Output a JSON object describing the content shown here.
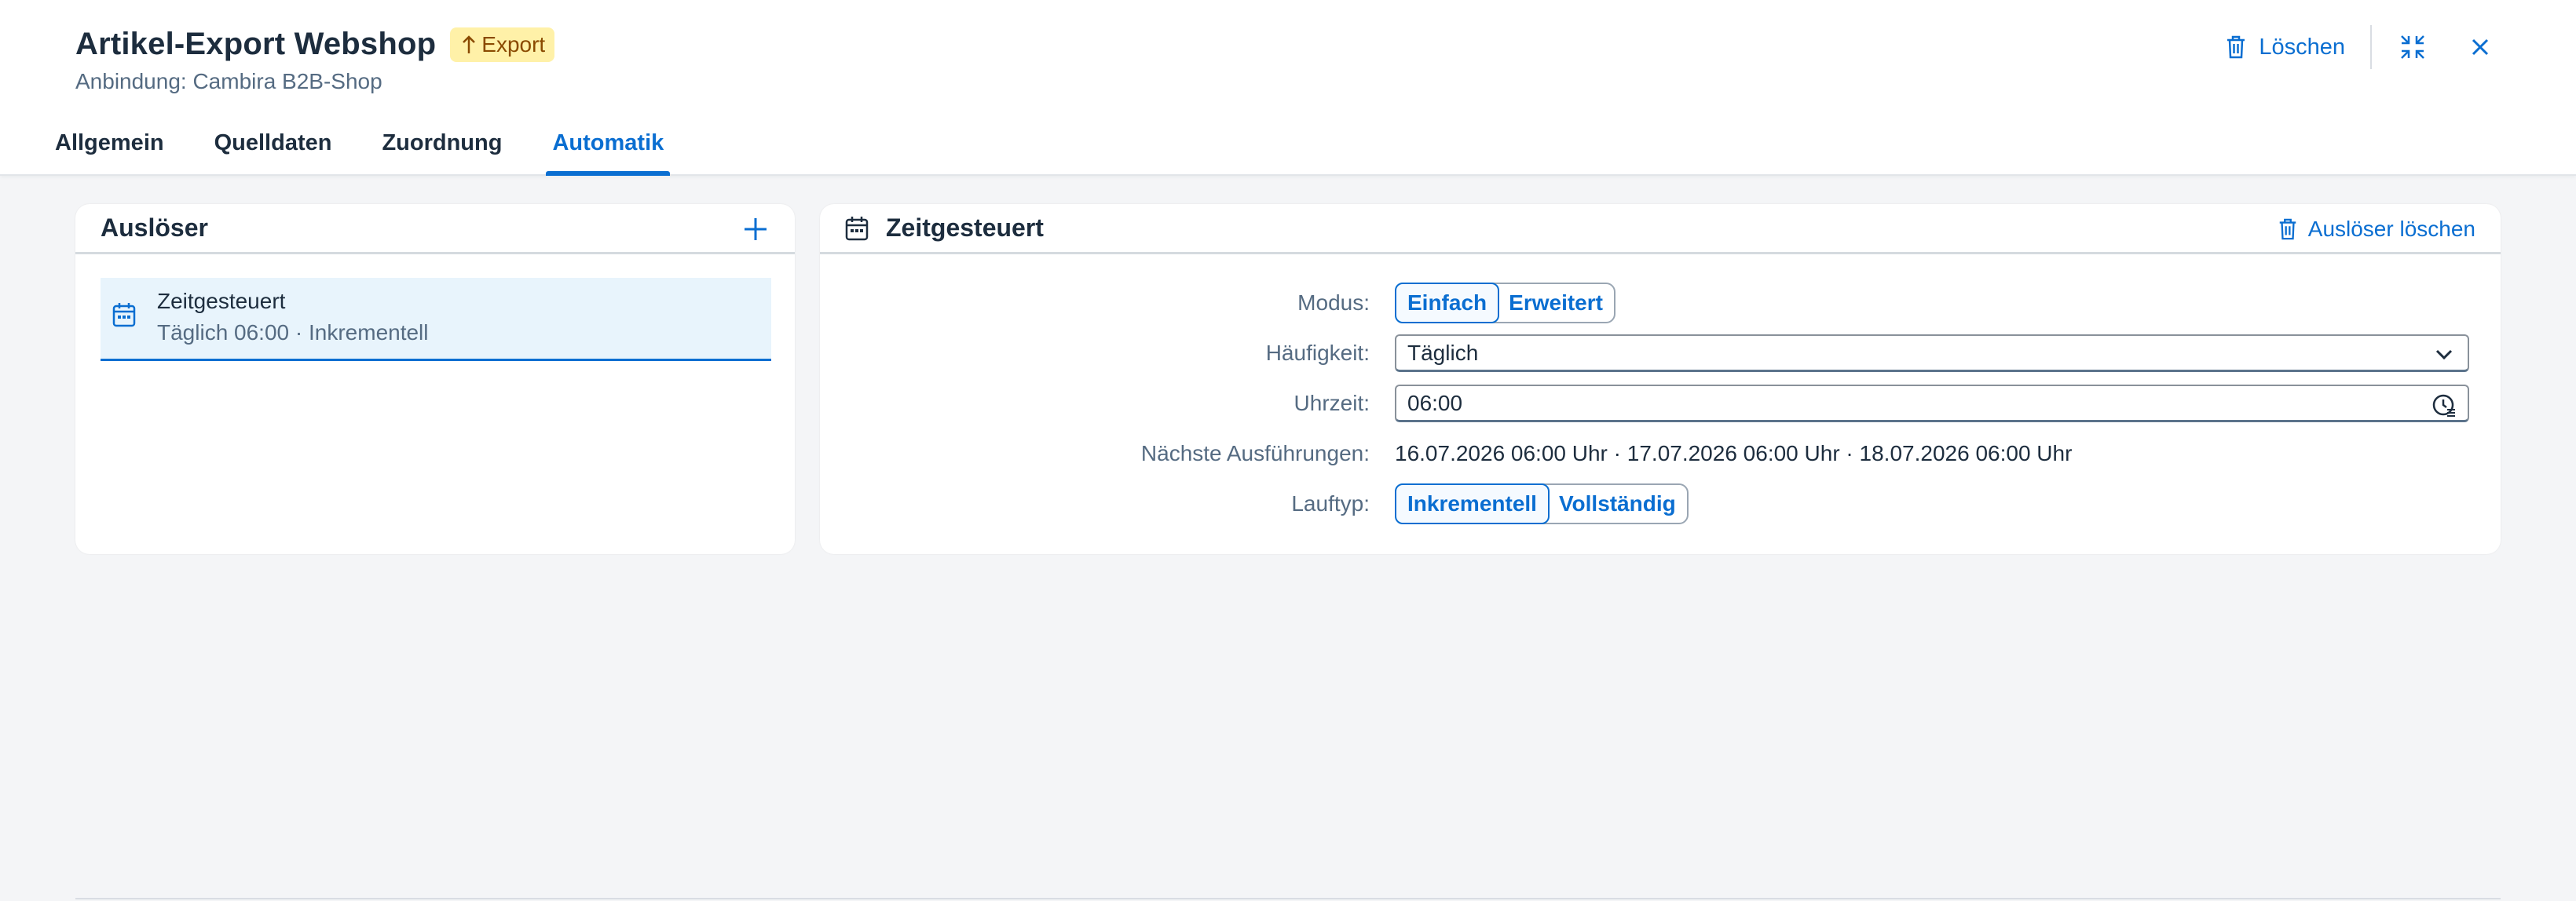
{
  "header": {
    "title": "Artikel-Export Webshop",
    "badge": "Export",
    "subtitle": "Anbindung: Cambira B2B-Shop",
    "delete_label": "Löschen"
  },
  "tabs": [
    {
      "label": "Allgemein"
    },
    {
      "label": "Quelldaten"
    },
    {
      "label": "Zuordnung"
    },
    {
      "label": "Automatik"
    }
  ],
  "triggers_panel": {
    "title": "Auslöser",
    "items": [
      {
        "title": "Zeitgesteuert",
        "description": "Täglich 06:00 · Inkrementell"
      }
    ]
  },
  "detail": {
    "title": "Zeitgesteuert",
    "delete_trigger_label": "Auslöser löschen",
    "mode": {
      "label": "Modus:",
      "options": [
        "Einfach",
        "Erweitert"
      ],
      "selected": "Einfach"
    },
    "frequency": {
      "label": "Häufigkeit:",
      "value": "Täglich"
    },
    "time": {
      "label": "Uhrzeit:",
      "value": "06:00"
    },
    "next_runs": {
      "label": "Nächste Ausführungen:",
      "value": "16.07.2026 06:00 Uhr · 17.07.2026 06:00 Uhr · 18.07.2026 06:00 Uhr"
    },
    "run_type": {
      "label": "Lauftyp:",
      "options": [
        "Inkrementell",
        "Vollständig"
      ],
      "selected": "Inkrementell"
    }
  },
  "colors": {
    "accent": "#0a6ed1",
    "badge_bg": "#fff1a8",
    "badge_text": "#8a4a00",
    "selected_item_bg": "#e8f4fc",
    "page_bg": "#f4f5f7"
  },
  "icons": {
    "badge": "arrow-up-icon",
    "delete": "trash-icon",
    "exit_fullscreen": "exit-fullscreen-icon",
    "close": "close-icon",
    "add": "plus-icon",
    "trigger": "calendar-icon",
    "dropdown": "chevron-down-icon",
    "time_picker": "clock-icon"
  }
}
